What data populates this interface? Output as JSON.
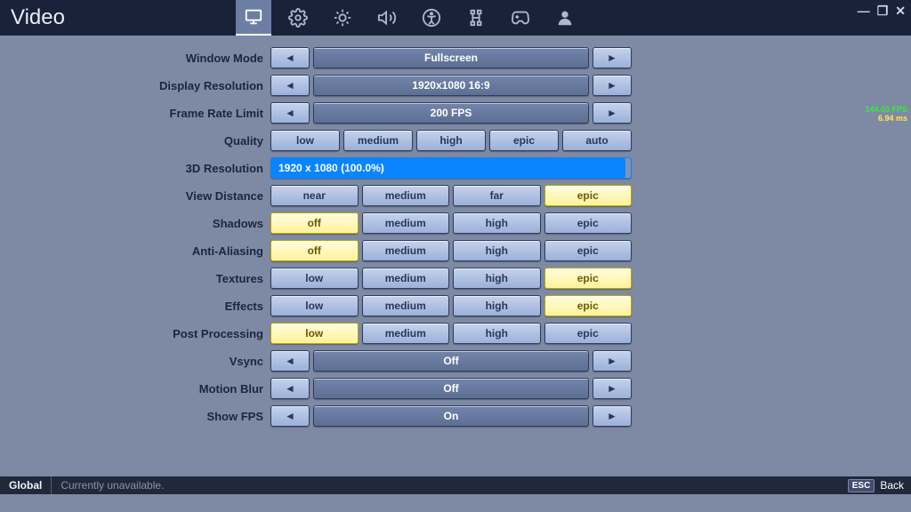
{
  "header": {
    "title": "Video",
    "tabs": [
      {
        "name": "display",
        "active": true
      },
      {
        "name": "settings",
        "active": false
      },
      {
        "name": "brightness",
        "active": false
      },
      {
        "name": "audio",
        "active": false
      },
      {
        "name": "accessibility",
        "active": false
      },
      {
        "name": "input",
        "active": false
      },
      {
        "name": "controller",
        "active": false
      },
      {
        "name": "account",
        "active": false
      }
    ],
    "window_controls": {
      "minimize": "—",
      "restore": "❐",
      "close": "✕"
    }
  },
  "fps_overlay": {
    "fps": "144.03 FPS",
    "ms": "6.94 ms"
  },
  "rows": [
    {
      "kind": "arrow",
      "key": "window_mode",
      "label": "Window Mode",
      "value": "Fullscreen"
    },
    {
      "kind": "arrow",
      "key": "display_resolution",
      "label": "Display Resolution",
      "value": "1920x1080 16:9"
    },
    {
      "kind": "arrow",
      "key": "frame_rate_limit",
      "label": "Frame Rate Limit",
      "value": "200 FPS"
    },
    {
      "kind": "opts",
      "key": "quality",
      "label": "Quality",
      "options": [
        "low",
        "medium",
        "high",
        "epic",
        "auto"
      ],
      "selected": null
    },
    {
      "kind": "slider",
      "key": "res_3d",
      "label": "3D Resolution",
      "value": "1920 x 1080 (100.0%)"
    },
    {
      "kind": "opts",
      "key": "view_distance",
      "label": "View Distance",
      "options": [
        "near",
        "medium",
        "far",
        "epic"
      ],
      "selected": "epic"
    },
    {
      "kind": "opts",
      "key": "shadows",
      "label": "Shadows",
      "options": [
        "off",
        "medium",
        "high",
        "epic"
      ],
      "selected": "off"
    },
    {
      "kind": "opts",
      "key": "anti_aliasing",
      "label": "Anti-Aliasing",
      "options": [
        "off",
        "medium",
        "high",
        "epic"
      ],
      "selected": "off"
    },
    {
      "kind": "opts",
      "key": "textures",
      "label": "Textures",
      "options": [
        "low",
        "medium",
        "high",
        "epic"
      ],
      "selected": "epic"
    },
    {
      "kind": "opts",
      "key": "effects",
      "label": "Effects",
      "options": [
        "low",
        "medium",
        "high",
        "epic"
      ],
      "selected": "epic"
    },
    {
      "kind": "opts",
      "key": "post_processing",
      "label": "Post Processing",
      "options": [
        "low",
        "medium",
        "high",
        "epic"
      ],
      "selected": "low"
    },
    {
      "kind": "arrow",
      "key": "vsync",
      "label": "Vsync",
      "value": "Off"
    },
    {
      "kind": "arrow",
      "key": "motion_blur",
      "label": "Motion Blur",
      "value": "Off"
    },
    {
      "kind": "arrow",
      "key": "show_fps",
      "label": "Show FPS",
      "value": "On"
    }
  ],
  "footer": {
    "scope": "Global",
    "status": "Currently unavailable.",
    "back_key": "ESC",
    "back_label": "Back"
  }
}
